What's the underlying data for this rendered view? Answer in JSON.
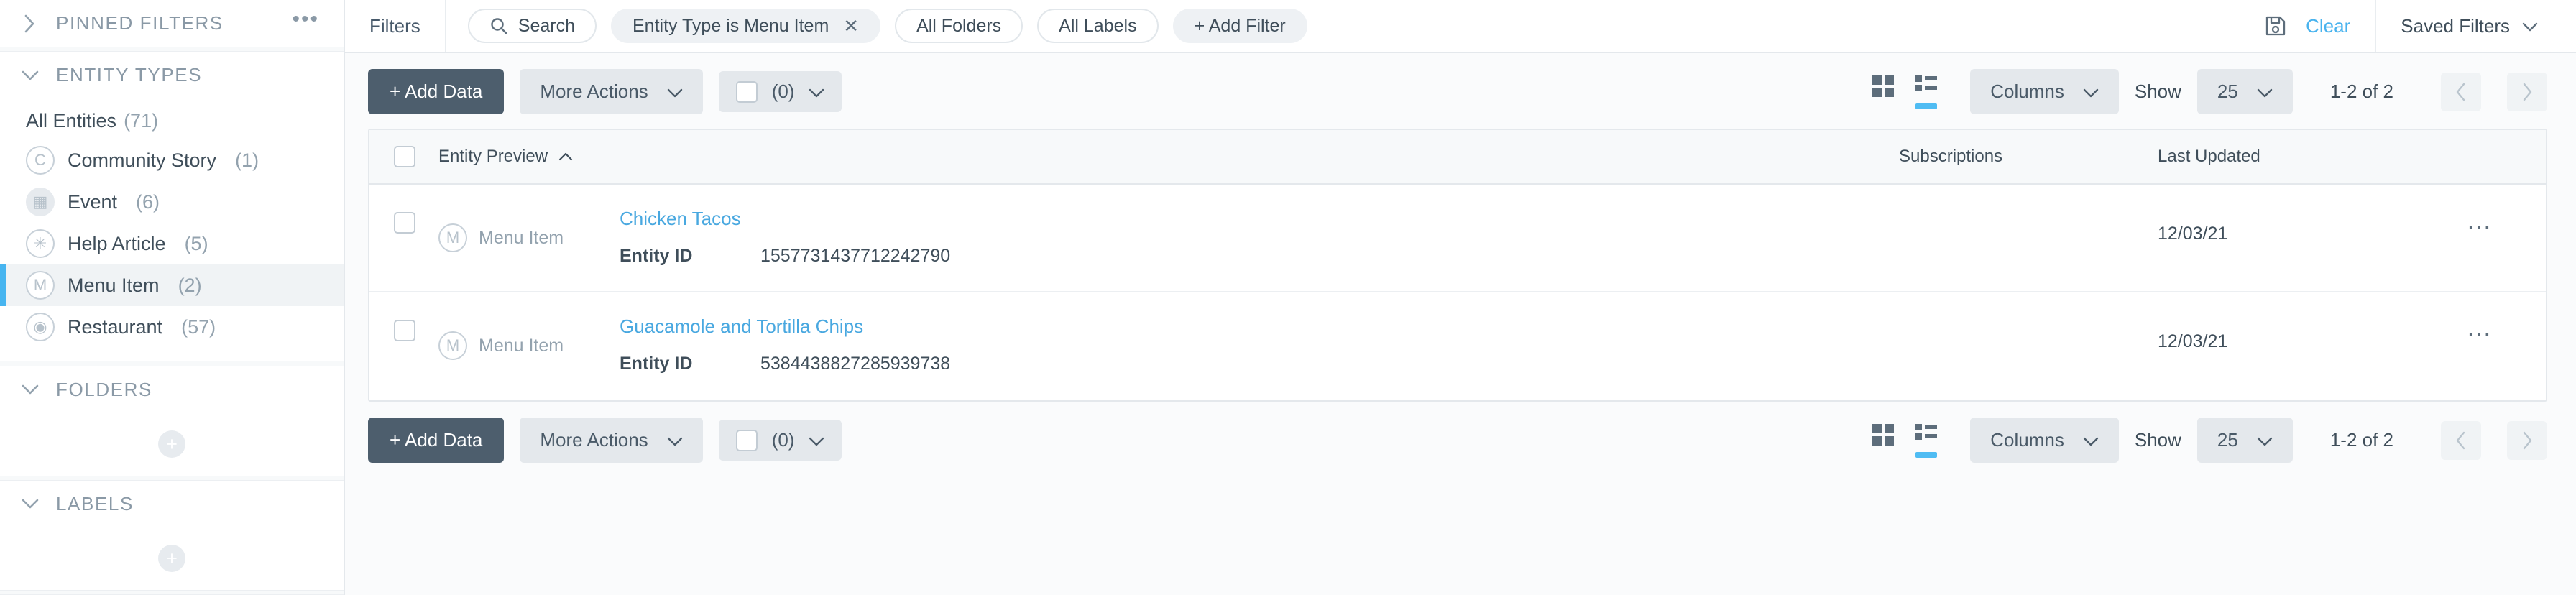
{
  "sidebar": {
    "pinned": {
      "title": "PINNED FILTERS",
      "menu_icon": "ellipsis-icon"
    },
    "entity_types": {
      "title": "ENTITY TYPES",
      "all_label": "All Entities",
      "all_count": "(71)",
      "items": [
        {
          "label": "Community Story",
          "count": "(1)",
          "glyph": "C",
          "icon": "community-story-icon",
          "active": false
        },
        {
          "label": "Event",
          "count": "(6)",
          "glyph": "▦",
          "icon": "calendar-icon",
          "active": false
        },
        {
          "label": "Help Article",
          "count": "(5)",
          "glyph": "✳",
          "icon": "lifebuoy-icon",
          "active": false
        },
        {
          "label": "Menu Item",
          "count": "(2)",
          "glyph": "M",
          "icon": "menu-item-icon",
          "active": true
        },
        {
          "label": "Restaurant",
          "count": "(57)",
          "glyph": "◉",
          "icon": "map-pin-icon",
          "active": false
        }
      ]
    },
    "folders": {
      "title": "FOLDERS",
      "add_label": "+"
    },
    "labels": {
      "title": "LABELS",
      "add_label": "+"
    }
  },
  "filterbar": {
    "label": "Filters",
    "chips": [
      {
        "text": "Search",
        "icon": "search-icon",
        "style": "outline",
        "removable": false
      },
      {
        "text": "Entity Type is Menu Item",
        "icon": "",
        "style": "solid",
        "removable": true,
        "remove_label": "✕"
      },
      {
        "text": "All Folders",
        "icon": "",
        "style": "outline",
        "removable": false
      },
      {
        "text": "All Labels",
        "icon": "",
        "style": "outline",
        "removable": false
      },
      {
        "text": "+ Add Filter",
        "icon": "",
        "style": "solid",
        "removable": false
      }
    ],
    "save_icon": "save-icon",
    "clear_label": "Clear",
    "saved_filters_label": "Saved Filters",
    "accent_link_color": "#49b3ee"
  },
  "toolbar": {
    "add_data_label": "+ Add Data",
    "more_actions_label": "More Actions",
    "selected_count_label": "(0)",
    "columns_label": "Columns",
    "show_label": "Show",
    "page_size": "25",
    "pager_range": "1-2 of 2",
    "grid_view_icon": "grid-view-icon",
    "list_view_icon": "list-view-icon",
    "prev_icon": "chevron-left-icon",
    "next_icon": "chevron-right-icon",
    "active_view": "list",
    "accent_color": "#4fbcf3"
  },
  "table": {
    "headers": {
      "entity_preview": "Entity Preview",
      "sort_icon": "sort-asc-icon",
      "subscriptions": "Subscriptions",
      "last_updated": "Last Updated"
    },
    "rows": [
      {
        "type_label": "Menu Item",
        "type_glyph": "M",
        "name": "Chicken Tacos",
        "field_key": "Entity ID",
        "field_value": "1557731437712242790",
        "subscriptions": "",
        "last_updated": "12/03/21",
        "row_menu": "⋯"
      },
      {
        "type_label": "Menu Item",
        "type_glyph": "M",
        "name": "Guacamole and Tortilla Chips",
        "field_key": "Entity ID",
        "field_value": "5384438827285939738",
        "subscriptions": "",
        "last_updated": "12/03/21",
        "row_menu": "⋯"
      }
    ]
  }
}
